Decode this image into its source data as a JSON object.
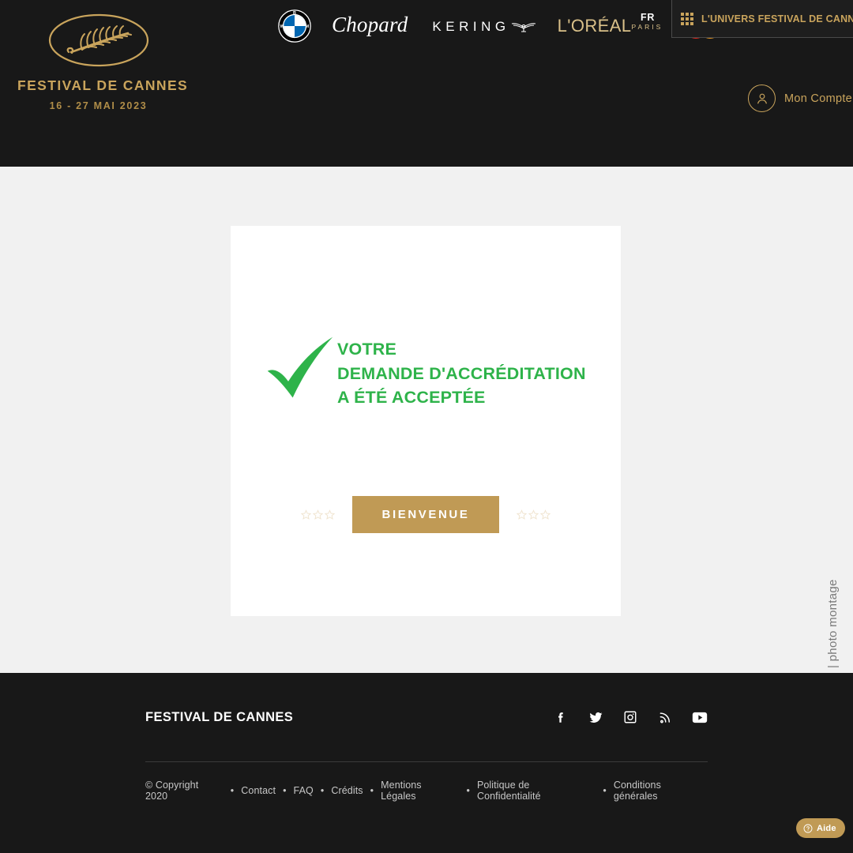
{
  "header": {
    "logo": {
      "icon": "palm-branch-icon",
      "title": "FESTIVAL DE CANNES",
      "dates": "16 - 27 MAI 2023"
    },
    "sponsors": [
      {
        "name": "bmw-logo",
        "label": "BMW"
      },
      {
        "name": "chopard-logo",
        "label": "Chopard"
      },
      {
        "name": "kering-logo",
        "label": "KERING"
      },
      {
        "name": "loreal-logo",
        "label": "L'ORÉAL",
        "sub": "PARIS"
      },
      {
        "name": "mastercard-logo",
        "label": "Mastercard"
      }
    ],
    "language": "FR",
    "universe_label": "L'UNIVERS FESTIVAL DE CANNES",
    "universe_icon": "grid-icon",
    "account_label": "Mon Compte",
    "account_icon": "user-icon"
  },
  "main": {
    "check_icon": "green-checkmark-icon",
    "message_lines": [
      "VOTRE",
      "DEMANDE D'ACCRÉDITATION",
      "A ÉTÉ ACCEPTÉE"
    ],
    "cta_label": "BIENVENUE",
    "stars_left": [
      "star-outline-icon",
      "star-outline-icon",
      "star-outline-icon"
    ],
    "stars_right": [
      "star-outline-icon",
      "star-outline-icon",
      "star-outline-icon"
    ],
    "photo_credit": "| photo montage"
  },
  "footer": {
    "brand": "FESTIVAL DE CANNES",
    "socials": [
      {
        "name": "facebook-icon",
        "label": "Facebook"
      },
      {
        "name": "twitter-icon",
        "label": "Twitter"
      },
      {
        "name": "instagram-icon",
        "label": "Instagram"
      },
      {
        "name": "rss-icon",
        "label": "RSS"
      },
      {
        "name": "youtube-icon",
        "label": "YouTube"
      }
    ],
    "copyright": "© Copyright 2020",
    "links": [
      "Contact",
      "FAQ",
      "Crédits",
      "Mentions Légales",
      "Politique de Confidentialité",
      "Conditions générales"
    ],
    "separator": "•"
  },
  "help": {
    "label": "Aide",
    "icon": "question-circle-icon"
  },
  "colors": {
    "gold": "#C9A45C",
    "button_gold": "#C09A55",
    "success_green": "#2EB34A",
    "dark": "#181818",
    "page_bg": "#F1F1F1",
    "card_bg": "#FFFFFF"
  }
}
